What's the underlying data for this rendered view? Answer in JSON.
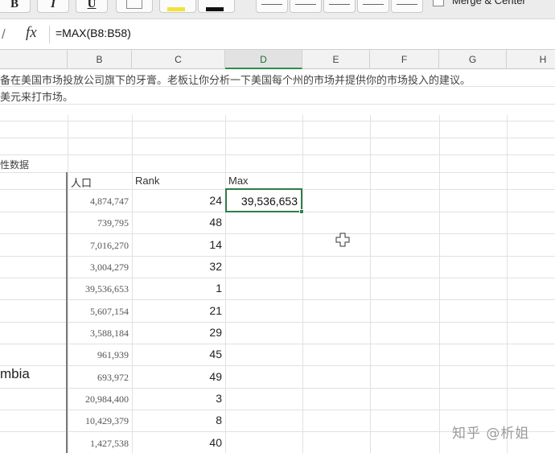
{
  "toolbar": {
    "bold_label": "B",
    "italic_label": "I",
    "underline_label": "U",
    "merge_label": "Merge & Center",
    "fill_color": "#f1e33a",
    "font_color": "#111111"
  },
  "formula_bar": {
    "fx_label": "fx",
    "formula": "=MAX(B8:B58)"
  },
  "columns": [
    "B",
    "C",
    "D",
    "E",
    "F",
    "G",
    "H"
  ],
  "active_column": "D",
  "intro": {
    "line1": "备在美国市场投放公司旗下的牙膏。老板让你分析一下美国每个州的市场并提供你的市场投入的建议。",
    "line2": "美元来打市场。"
  },
  "section_label": "性数据",
  "table": {
    "header_population": "人口",
    "header_rank": "Rank",
    "header_max": "Max",
    "max_value": "39,536,653",
    "partial_state_label": "mbia",
    "rows": [
      {
        "population": "4,874,747",
        "rank": "24"
      },
      {
        "population": "739,795",
        "rank": "48"
      },
      {
        "population": "7,016,270",
        "rank": "14"
      },
      {
        "population": "3,004,279",
        "rank": "32"
      },
      {
        "population": "39,536,653",
        "rank": "1"
      },
      {
        "population": "5,607,154",
        "rank": "21"
      },
      {
        "population": "3,588,184",
        "rank": "29"
      },
      {
        "population": "961,939",
        "rank": "45"
      },
      {
        "population": "693,972",
        "rank": "49"
      },
      {
        "population": "20,984,400",
        "rank": "3"
      },
      {
        "population": "10,429,379",
        "rank": "8"
      },
      {
        "population": "1,427,538",
        "rank": "40"
      }
    ]
  },
  "watermark": "知乎 @析姐"
}
